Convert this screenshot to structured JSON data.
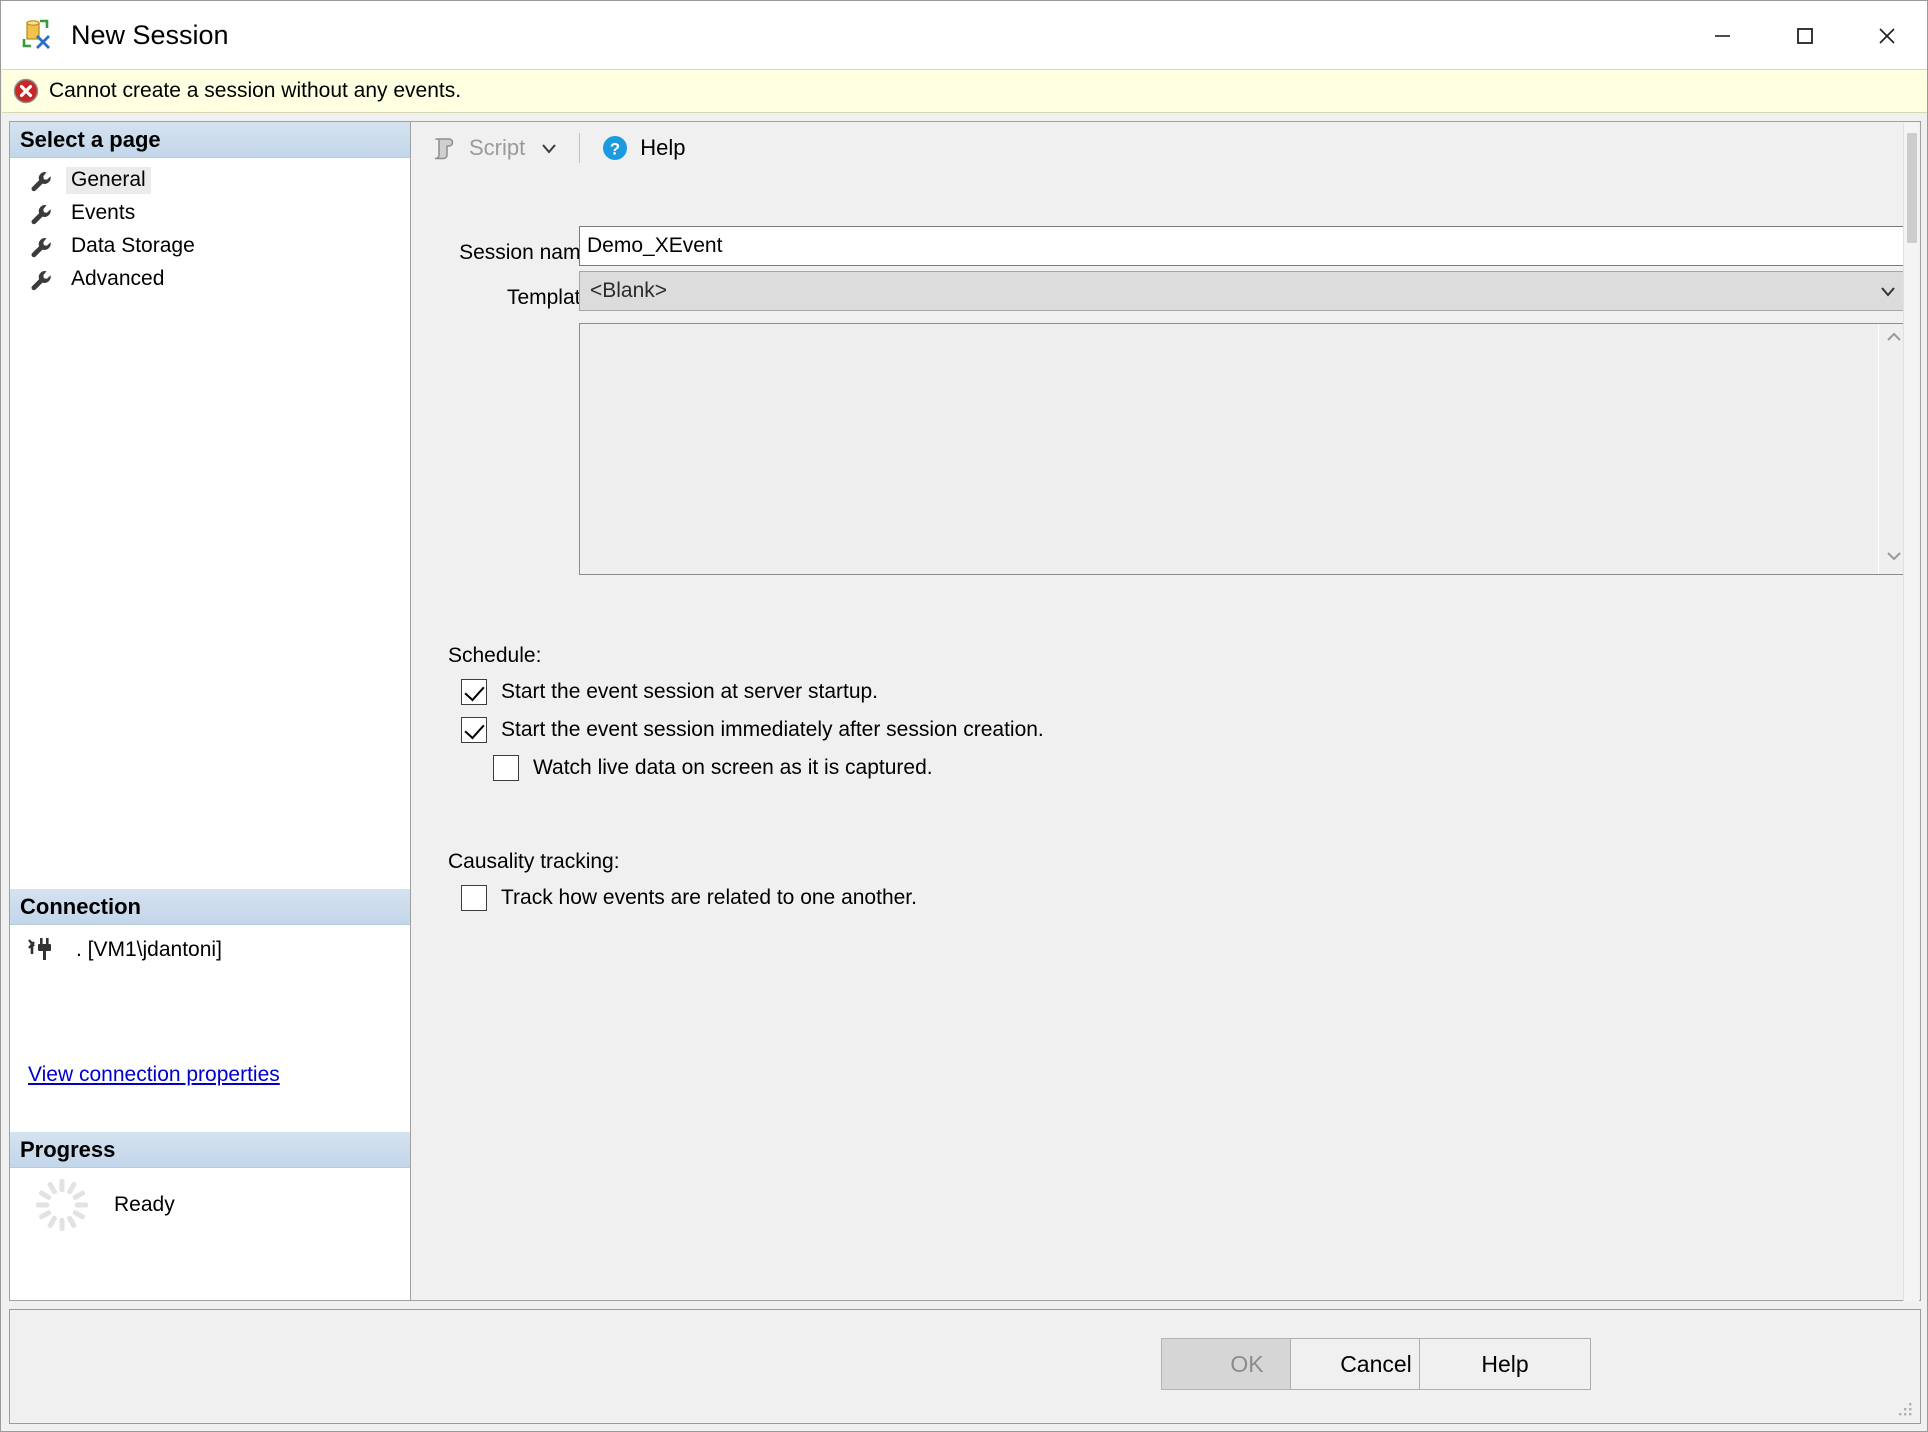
{
  "window": {
    "title": "New Session",
    "icon": "new-session-icon",
    "minimize": "minimize-icon",
    "maximize": "maximize-icon",
    "close": "close-icon"
  },
  "warning": {
    "icon": "error-icon",
    "message": "Cannot create a session without any events.",
    "background": "#ffffe1"
  },
  "sidebar": {
    "select_page_header": "Select a page",
    "items": [
      {
        "label": "General",
        "icon": "wrench-icon",
        "selected": true
      },
      {
        "label": "Events",
        "icon": "wrench-icon",
        "selected": false
      },
      {
        "label": "Data Storage",
        "icon": "wrench-icon",
        "selected": false
      },
      {
        "label": "Advanced",
        "icon": "wrench-icon",
        "selected": false
      }
    ],
    "connection": {
      "header": "Connection",
      "icon": "connection-plug-icon",
      "server": ". [VM1\\jdantoni]",
      "link": "View connection properties"
    },
    "progress": {
      "header": "Progress",
      "icon": "spinner-icon",
      "status": "Ready"
    }
  },
  "toolbar": {
    "script": {
      "label": "Script",
      "icon": "script-icon",
      "caret": "chevron-down-icon",
      "disabled": true
    },
    "help": {
      "label": "Help",
      "icon": "help-circle-icon",
      "disabled": false
    }
  },
  "form": {
    "session_name": {
      "label": "Session name:",
      "value": "Demo_XEvent",
      "placeholder": ""
    },
    "template": {
      "label": "Template:",
      "value": "<Blank>",
      "options": [
        "<Blank>"
      ]
    },
    "template_description": {
      "value": ""
    },
    "schedule": {
      "label": "Schedule:",
      "options": [
        {
          "label": "Start the event session at server startup.",
          "checked": true
        },
        {
          "label": "Start the event session immediately after session creation.",
          "checked": true
        },
        {
          "label": "Watch live data on screen as it is captured.",
          "checked": false,
          "indented": true
        }
      ]
    },
    "causality": {
      "label": "Causality tracking:",
      "options": [
        {
          "label": "Track how events are related to one another.",
          "checked": false
        }
      ]
    }
  },
  "footer": {
    "ok": {
      "label": "OK",
      "disabled": true
    },
    "cancel": {
      "label": "Cancel",
      "disabled": false
    },
    "help": {
      "label": "Help",
      "disabled": false
    },
    "resize_grip": "resize-grip-icon"
  },
  "colors": {
    "dialog_bg": "#f0f0f0",
    "panel_header": "#c8d9ea",
    "warning_bg": "#ffffe1",
    "link": "#0000cc",
    "error_red": "#cc2222",
    "help_blue": "#1c9ae0"
  }
}
